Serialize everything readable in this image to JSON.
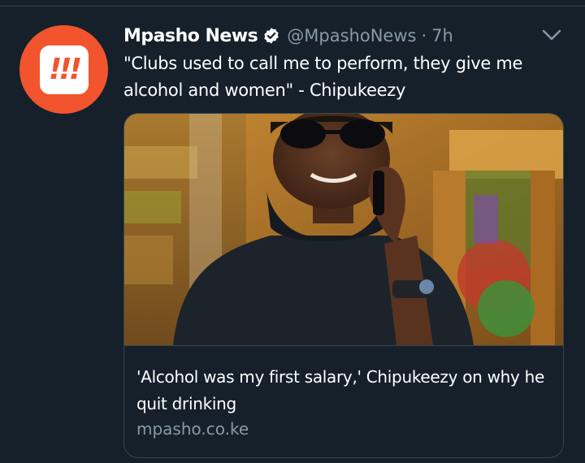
{
  "tweet": {
    "author_name": "Mpasho News",
    "handle": "@MpashoNews",
    "separator": "·",
    "time": "7h",
    "text": "\"Clubs used to call me to perform, they give me alcohol and women\" - Chipukeezy",
    "avatar_glyph": "!!!"
  },
  "card": {
    "title": "'Alcohol was my first salary,' Chipukeezy on why he quit drinking",
    "domain": "mpasho.co.ke"
  },
  "colors": {
    "background": "#15202b",
    "brand_orange": "#f2542d",
    "verified_blue": "#ffffff",
    "secondary_text": "#8899a6",
    "border": "#38444d"
  },
  "icons": {
    "verified": "verified-badge-icon",
    "more": "chevron-down-icon"
  }
}
